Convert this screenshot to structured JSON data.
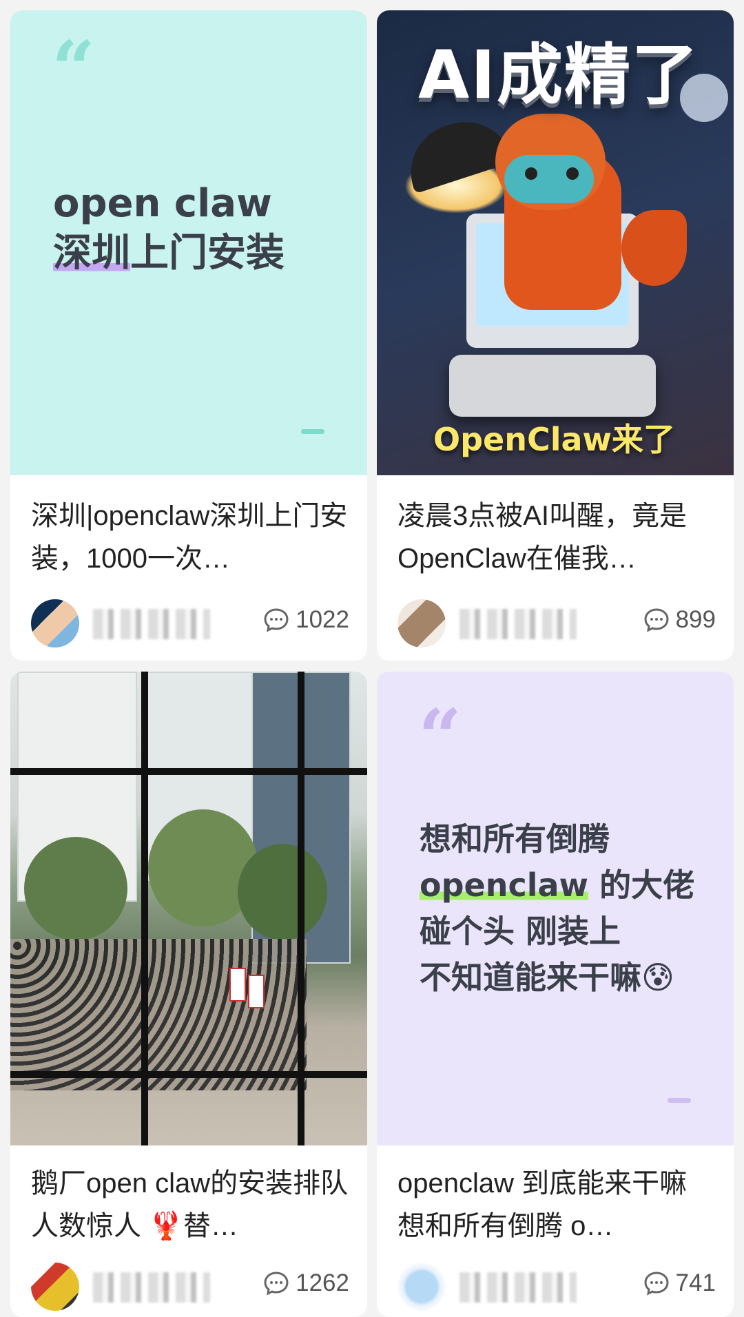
{
  "cards": [
    {
      "cover": {
        "line1": "open claw",
        "line2_highlight": "深圳",
        "line2_rest": "上门安装"
      },
      "title": "深圳|openclaw深圳上门安装，1000一次…",
      "author": "",
      "comments": "1022"
    },
    {
      "cover": {
        "title": "AI成精了",
        "subtitle": "OpenClaw来了"
      },
      "title": "凌晨3点被AI叫醒，竟是OpenClaw在催我…",
      "author": "",
      "comments": "899"
    },
    {
      "title": "鹅厂open claw的安装排队人数惊人 🦞替…",
      "author": "",
      "comments": "1262"
    },
    {
      "cover": {
        "line1": "想和所有倒腾",
        "line2_highlight": "openclaw",
        "line2_rest": " 的大佬",
        "line3": "碰个头 刚装上",
        "line4": "不知道能来干嘛😰"
      },
      "title": "openclaw 到底能来干嘛 想和所有倒腾 o…",
      "author": "",
      "comments": "741"
    }
  ],
  "icons": {
    "comment": "comment-bubble-icon",
    "quote": "quote-mark-icon"
  }
}
